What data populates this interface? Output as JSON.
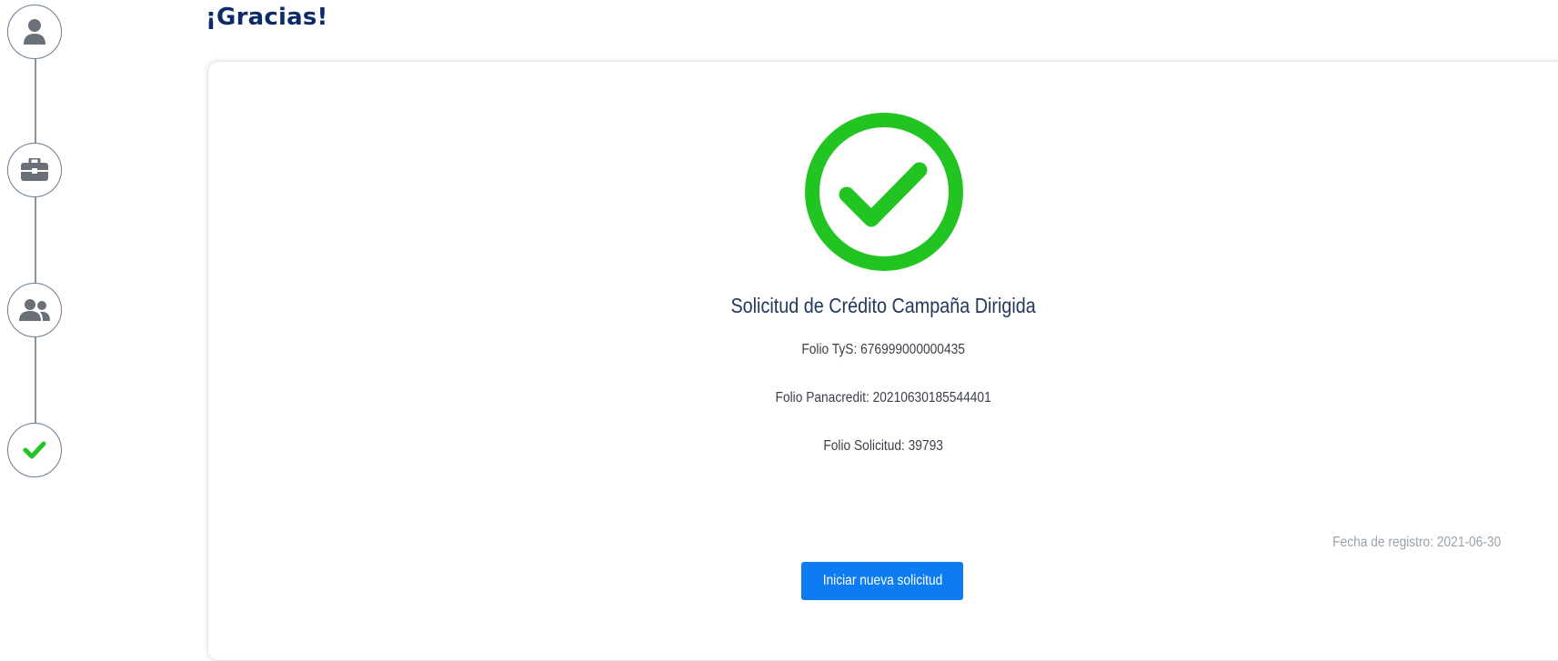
{
  "page": {
    "title": "¡Gracias!"
  },
  "stepper": {
    "steps": [
      {
        "icon": "user-icon",
        "state": "done"
      },
      {
        "icon": "briefcase-icon",
        "state": "done"
      },
      {
        "icon": "users-icon",
        "state": "done"
      },
      {
        "icon": "check-icon",
        "state": "current"
      }
    ]
  },
  "card": {
    "icon": "check-circle-icon",
    "title": "Solicitud de Crédito Campaña Dirigida",
    "folio_tys": "Folio TyS: 676999000000435",
    "folio_panacredit": "Folio Panacredit: 20210630185544401",
    "folio_solicitud": "Folio Solicitud: 39793",
    "fecha_registro": "Fecha de registro: 2021-06-30",
    "new_request_button": "Iniciar nueva solicitud"
  },
  "colors": {
    "title": "#0d2b66",
    "success_green": "#22c422",
    "button_blue": "#0d7bf2",
    "step_icon": "#6a7078",
    "step_border": "#6b7a92"
  }
}
